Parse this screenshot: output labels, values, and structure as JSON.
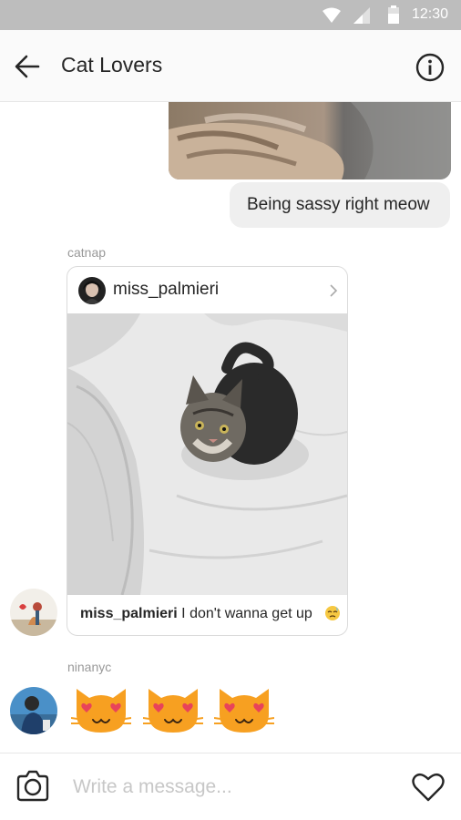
{
  "status_bar": {
    "time": "12:30"
  },
  "header": {
    "title": "Cat Lovers",
    "back_icon": "arrow-left-icon",
    "info_icon": "info-icon"
  },
  "messages": {
    "text_message": "Being sassy right meow",
    "shared_post": {
      "sender": "catnap",
      "username": "miss_palmieri",
      "caption_user": "miss_palmieri",
      "caption_text": " I don't wanna get up",
      "caption_emoji": "sleepy-face-emoji"
    },
    "emoji_message": {
      "sender": "ninanyc",
      "emojis": [
        "heart-eyes-cat-emoji",
        "heart-eyes-cat-emoji",
        "heart-eyes-cat-emoji"
      ]
    }
  },
  "composer": {
    "placeholder": "Write a message...",
    "camera_icon": "camera-icon",
    "heart_icon": "heart-icon"
  },
  "colors": {
    "bubble_bg": "#efefef",
    "meta_text": "#999999",
    "emoji_orange": "#f7a021",
    "emoji_hearts": "#e8435a"
  }
}
